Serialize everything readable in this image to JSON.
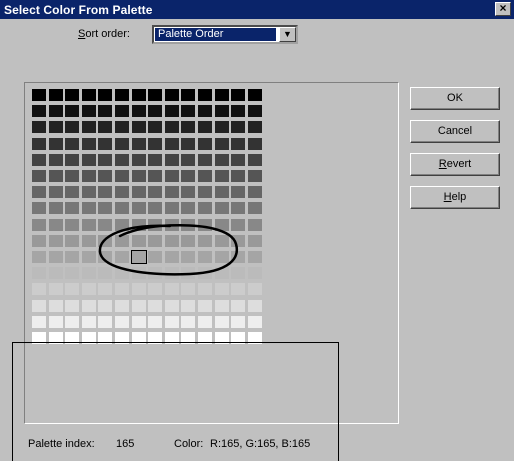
{
  "window": {
    "title": "Select Color From Palette",
    "close_glyph": "×"
  },
  "sort": {
    "label_accel": "S",
    "label_rest": "ort order:",
    "value": "Palette Order",
    "arrow_glyph": "▼"
  },
  "palette": {
    "columns": 14,
    "rows": [
      [
        0,
        0,
        0,
        0,
        0,
        0,
        0,
        0,
        0,
        0,
        0,
        0,
        0,
        0
      ],
      [
        17,
        17,
        17,
        17,
        17,
        17,
        17,
        17,
        17,
        17,
        17,
        17,
        17,
        17
      ],
      [
        34,
        34,
        34,
        34,
        34,
        34,
        34,
        34,
        34,
        34,
        34,
        34,
        34,
        34
      ],
      [
        51,
        51,
        51,
        51,
        51,
        51,
        51,
        51,
        51,
        51,
        51,
        51,
        51,
        51
      ],
      [
        68,
        68,
        68,
        68,
        68,
        68,
        68,
        68,
        68,
        68,
        68,
        68,
        68,
        68
      ],
      [
        85,
        85,
        85,
        85,
        85,
        85,
        85,
        85,
        85,
        85,
        85,
        85,
        85,
        85
      ],
      [
        102,
        102,
        102,
        102,
        102,
        102,
        102,
        102,
        102,
        102,
        102,
        102,
        102,
        102
      ],
      [
        119,
        119,
        119,
        119,
        119,
        119,
        119,
        119,
        119,
        119,
        119,
        119,
        119,
        119
      ],
      [
        136,
        136,
        136,
        136,
        136,
        136,
        136,
        136,
        136,
        136,
        136,
        136,
        136,
        136
      ],
      [
        153,
        153,
        153,
        153,
        153,
        153,
        153,
        153,
        153,
        153,
        153,
        153,
        153,
        153
      ],
      [
        165,
        165,
        165,
        165,
        165,
        165,
        165,
        165,
        165,
        165,
        165,
        165,
        165,
        165
      ],
      [
        187,
        187,
        187,
        187,
        187,
        187,
        187,
        187,
        187,
        187,
        187,
        187,
        187,
        187
      ],
      [
        204,
        204,
        204,
        204,
        204,
        204,
        204,
        204,
        204,
        204,
        204,
        204,
        204,
        204
      ],
      [
        221,
        221,
        221,
        221,
        221,
        221,
        221,
        221,
        221,
        221,
        221,
        221,
        221,
        221
      ],
      [
        238,
        238,
        238,
        238,
        238,
        238,
        238,
        238,
        238,
        238,
        238,
        238,
        238,
        238
      ],
      [
        255,
        255,
        255,
        255,
        255,
        255,
        255,
        255,
        255,
        255,
        255,
        255,
        255,
        255
      ]
    ],
    "selected": {
      "row": 10,
      "col": 6
    }
  },
  "buttons": [
    {
      "name": "ok-button",
      "accel": "",
      "rest": "OK"
    },
    {
      "name": "cancel-button",
      "accel": "",
      "rest": "Cancel"
    },
    {
      "name": "revert-button",
      "accel": "R",
      "rest": "evert"
    },
    {
      "name": "help-button",
      "accel": "H",
      "rest": "elp"
    }
  ],
  "status": {
    "index_label": "Palette index:",
    "index_value": "165",
    "color_label": "Color:",
    "color_value": "R:165, G:165, B:165"
  }
}
